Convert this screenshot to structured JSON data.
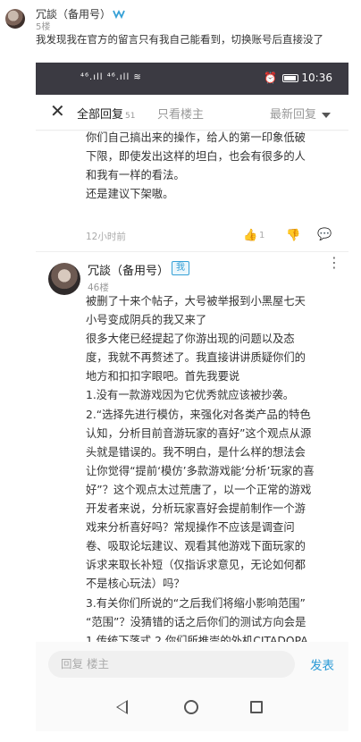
{
  "outer_comment": {
    "name": "冗談（备用号）",
    "badge_icon": "verified-icon",
    "floor": "5楼",
    "text": "我发现我在官方的留言只有我自己能看到，切换账号后直接没了"
  },
  "status_bar": {
    "signal": "⁴⁶.ıll ⁴⁶.ıll ≋",
    "time": "10:36"
  },
  "top_bar": {
    "all_replies": "全部回复",
    "all_count": "51",
    "only_owner": "只看楼主",
    "sort": "最新回复"
  },
  "previous_reply": {
    "lines": [
      "你们自己搞出来的操作，给人的第一印象低破",
      "下限，即使发出这样的坦白，也会有很多的人",
      "和我有一样的看法。",
      "还是建议下架嗷。"
    ],
    "time": "12小时前",
    "likes": "1"
  },
  "reply": {
    "name": "冗談（备用号）",
    "op_badge": "我",
    "floor": "46楼",
    "lines": [
      "被删了十来个帖子，大号被举报到小黑屋七天",
      "小号变成阴兵的我又来了",
      "很多大佬已经提起了你游出现的问题以及态",
      "度，我就不再赘述了。我直接讲讲质疑你们的",
      "地方和扣扣字眼吧。首先我要说",
      " 1.没有一款游戏因为它优秀就应该被抄袭。",
      " 2.“选择先进行模仿，来强化对各类产品的特色",
      "认知，分析目前音游玩家的喜好”这个观点从源",
      "头就是错误的。我不明白，是什么样的想法会",
      "让你觉得“提前‘模仿’多款游戏能‘分析’玩家的喜",
      "好”？这个观点太过荒唐了，以一个正常的游戏",
      "开发者来说，分析玩家喜好会提前制作一个游",
      "戏来分析喜好吗？常规操作不应该是调查问",
      "卷、吸取论坛建议、观看其他游戏下面玩家的",
      "诉求来取长补短（仅指诉求意见，无论如何都",
      "不是核心玩法）吗？",
      "3.有关你们所说的“之后我们将缩小影响范围”",
      "“范围”？没猜错的话之后你们的测试方向会是",
      "1.传统下落式 2.你们所推崇的外机CITADOPA"
    ]
  },
  "reply_bar": {
    "placeholder": "回复 楼主",
    "send": "发表"
  }
}
